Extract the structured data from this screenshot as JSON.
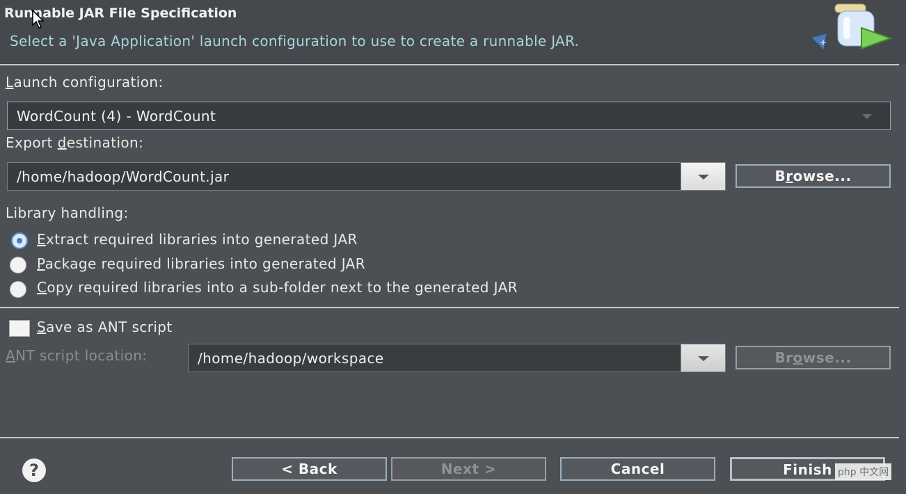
{
  "header": {
    "title": "Runnable JAR File Specification",
    "subtitle": "Select a 'Java Application' launch configuration to use to create a runnable JAR."
  },
  "launch": {
    "label_mnemonic": "L",
    "label_rest": "aunch configuration:",
    "value": "WordCount (4) - WordCount"
  },
  "export": {
    "label_pre": "Export ",
    "label_mnemonic": "d",
    "label_rest": "estination:",
    "value": "/home/hadoop/WordCount.jar",
    "browse_pre": "B",
    "browse_mnemonic": "r",
    "browse_rest": "owse..."
  },
  "library": {
    "label": "Library handling:",
    "options": [
      {
        "mnemonic": "E",
        "rest": "xtract required libraries into generated JAR"
      },
      {
        "mnemonic": "P",
        "rest": "ackage required libraries into generated JAR"
      },
      {
        "mnemonic": "C",
        "rest": "opy required libraries into a sub-folder next to the generated JAR"
      }
    ]
  },
  "ant": {
    "save_mnemonic": "S",
    "save_rest": "ave as ANT script",
    "location_mnemonic": "A",
    "location_rest": "NT script location:",
    "location_value": "/home/hadoop/workspace",
    "browse_pre": "Br",
    "browse_mnemonic": "o",
    "browse_rest": "wse..."
  },
  "footer": {
    "help_glyph": "?",
    "back": "< Back",
    "next": "Next >",
    "cancel": "Cancel",
    "finish": "Finish"
  },
  "watermark": "php 中文网"
}
